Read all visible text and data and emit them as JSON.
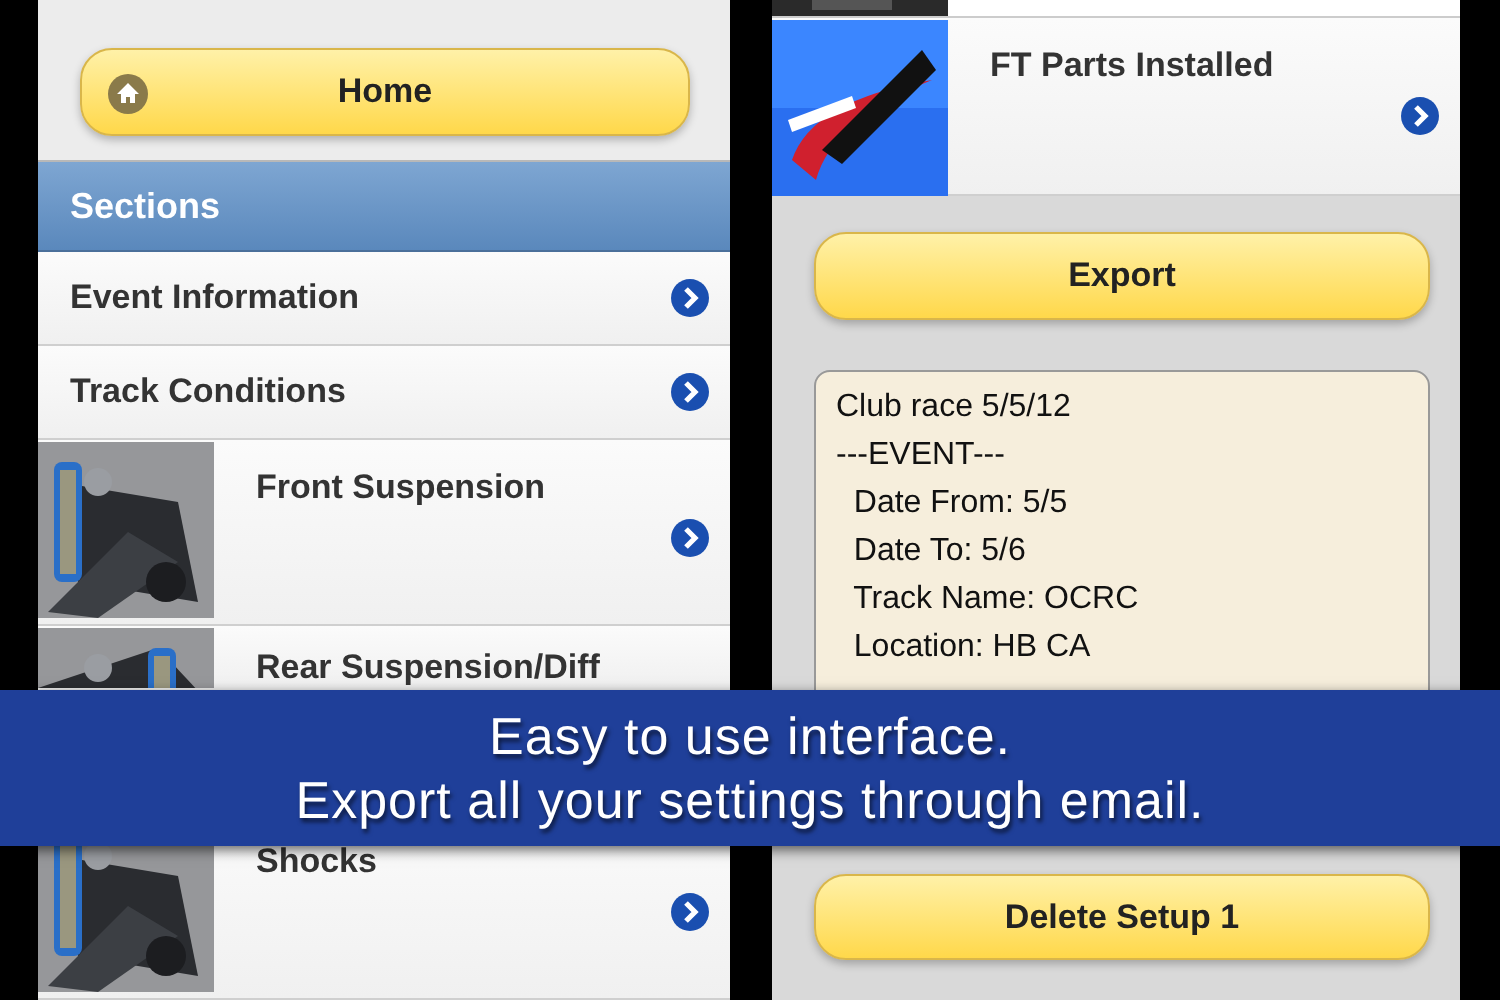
{
  "left_screen": {
    "home_button": "Home",
    "section_header": "Sections",
    "items": [
      {
        "kind": "plain",
        "label": "Event Information"
      },
      {
        "kind": "plain",
        "label": "Track Conditions"
      },
      {
        "kind": "picture",
        "label": "Front Suspension"
      },
      {
        "kind": "picture",
        "label": "Rear Suspension/Diff"
      },
      {
        "kind": "picture",
        "label": "Shocks"
      }
    ]
  },
  "right_screen": {
    "items": [
      {
        "kind": "logo",
        "label": "FT Parts Installed"
      }
    ],
    "export_button": "Export",
    "export_text": [
      "Club race 5/5/12",
      "---EVENT---",
      "  Date From: 5/5",
      "  Date To: 5/6",
      "  Track Name: OCRC",
      "  Location: HB CA"
    ],
    "delete_button": "Delete Setup 1"
  },
  "banner": [
    "Easy to use interface.",
    "Export all your settings through email."
  ]
}
